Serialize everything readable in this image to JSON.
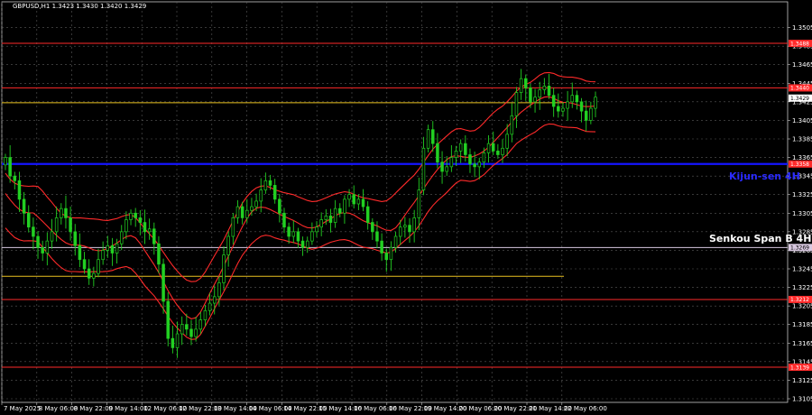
{
  "chart_data": {
    "type": "candlestick",
    "header": "GBPUSD,H1  1.3423 1.3430 1.3420 1.3429",
    "ylim": [
      1.3105,
      1.3525
    ],
    "y_ticks": [
      "1.3505",
      "1.3485",
      "1.3465",
      "1.3445",
      "1.3425",
      "1.3405",
      "1.3385",
      "1.3365",
      "1.3345",
      "1.3325",
      "1.3305",
      "1.3285",
      "1.3265",
      "1.3245",
      "1.3225",
      "1.3205",
      "1.3185",
      "1.3165",
      "1.3145",
      "1.3125",
      "1.3105"
    ],
    "x_ticks": [
      "7 May 2025",
      "8 May 06:00",
      "8 May 22:00",
      "9 May 14:00",
      "12 May 06:00",
      "12 May 22:00",
      "13 May 14:00",
      "14 May 06:00",
      "14 May 22:00",
      "15 May 14:00",
      "16 May 06:00",
      "16 May 22:00",
      "19 May 14:00",
      "20 May 06:00",
      "20 May 22:00",
      "21 May 14:00",
      "22 May 06:00"
    ],
    "levels": [
      {
        "price": 1.3488,
        "label": "1.3488",
        "color": "#ff2a2a",
        "style": "solid"
      },
      {
        "price": 1.344,
        "label": "1.3440",
        "color": "#ff2a2a",
        "style": "solid"
      },
      {
        "price": 1.3358,
        "label": "1.3358",
        "color": "#ff2a2a",
        "style": "solid"
      },
      {
        "price": 1.3358,
        "label": "",
        "color": "#1515ff",
        "style": "thick"
      },
      {
        "price": 1.3268,
        "label": "1.3269",
        "color": "#d8c8e0",
        "style": "solid"
      },
      {
        "price": 1.3212,
        "label": "1.3212",
        "color": "#ff2a2a",
        "style": "solid"
      },
      {
        "price": 1.3139,
        "label": "1.3139",
        "color": "#ff2a2a",
        "style": "solid"
      }
    ],
    "current_price": {
      "price": 1.3429,
      "label": "1.3429"
    },
    "channel": {
      "upper": 1.3424,
      "lower": 1.3237,
      "color": "#e8c020"
    },
    "annotations": [
      {
        "text": "Kijun-sen 4H",
        "color": "#2a2aff",
        "price": 1.3345
      },
      {
        "text": "Senkou Span B 4H",
        "color": "#ffffff",
        "price": 1.3278
      }
    ],
    "series": [
      {
        "name": "close",
        "values": [
          1.3365,
          1.3345,
          1.334,
          1.332,
          1.3305,
          1.329,
          1.328,
          1.3268,
          1.3262,
          1.3275,
          1.3285,
          1.33,
          1.331,
          1.33,
          1.3285,
          1.327,
          1.3255,
          1.3245,
          1.3235,
          1.324,
          1.3255,
          1.3265,
          1.327,
          1.3262,
          1.3272,
          1.3285,
          1.3298,
          1.3305,
          1.33,
          1.3295,
          1.3285,
          1.3288,
          1.3272,
          1.325,
          1.321,
          1.317,
          1.316,
          1.3175,
          1.3185,
          1.318,
          1.3172,
          1.318,
          1.319,
          1.32,
          1.3208,
          1.3215,
          1.323,
          1.326,
          1.328,
          1.33,
          1.3312,
          1.33,
          1.3308,
          1.3312,
          1.3318,
          1.333,
          1.334,
          1.3335,
          1.332,
          1.3305,
          1.329,
          1.328,
          1.3285,
          1.3275,
          1.3268,
          1.3275,
          1.3285,
          1.329,
          1.3298,
          1.3302,
          1.3295,
          1.331,
          1.3305,
          1.332,
          1.3325,
          1.3315,
          1.332,
          1.3312,
          1.3295,
          1.3285,
          1.3275,
          1.3262,
          1.3255,
          1.3268,
          1.328,
          1.329,
          1.3292,
          1.3285,
          1.33,
          1.333,
          1.3375,
          1.3395,
          1.338,
          1.336,
          1.335,
          1.3355,
          1.3365,
          1.3372,
          1.338,
          1.3368,
          1.3358,
          1.3355,
          1.336,
          1.337,
          1.338,
          1.3372,
          1.3368,
          1.3375,
          1.339,
          1.341,
          1.3435,
          1.345,
          1.344,
          1.3425,
          1.343,
          1.3438,
          1.3442,
          1.3432,
          1.342,
          1.3415,
          1.3418,
          1.3425,
          1.3432,
          1.3425,
          1.3415,
          1.3405,
          1.3418,
          1.343
        ]
      }
    ]
  }
}
